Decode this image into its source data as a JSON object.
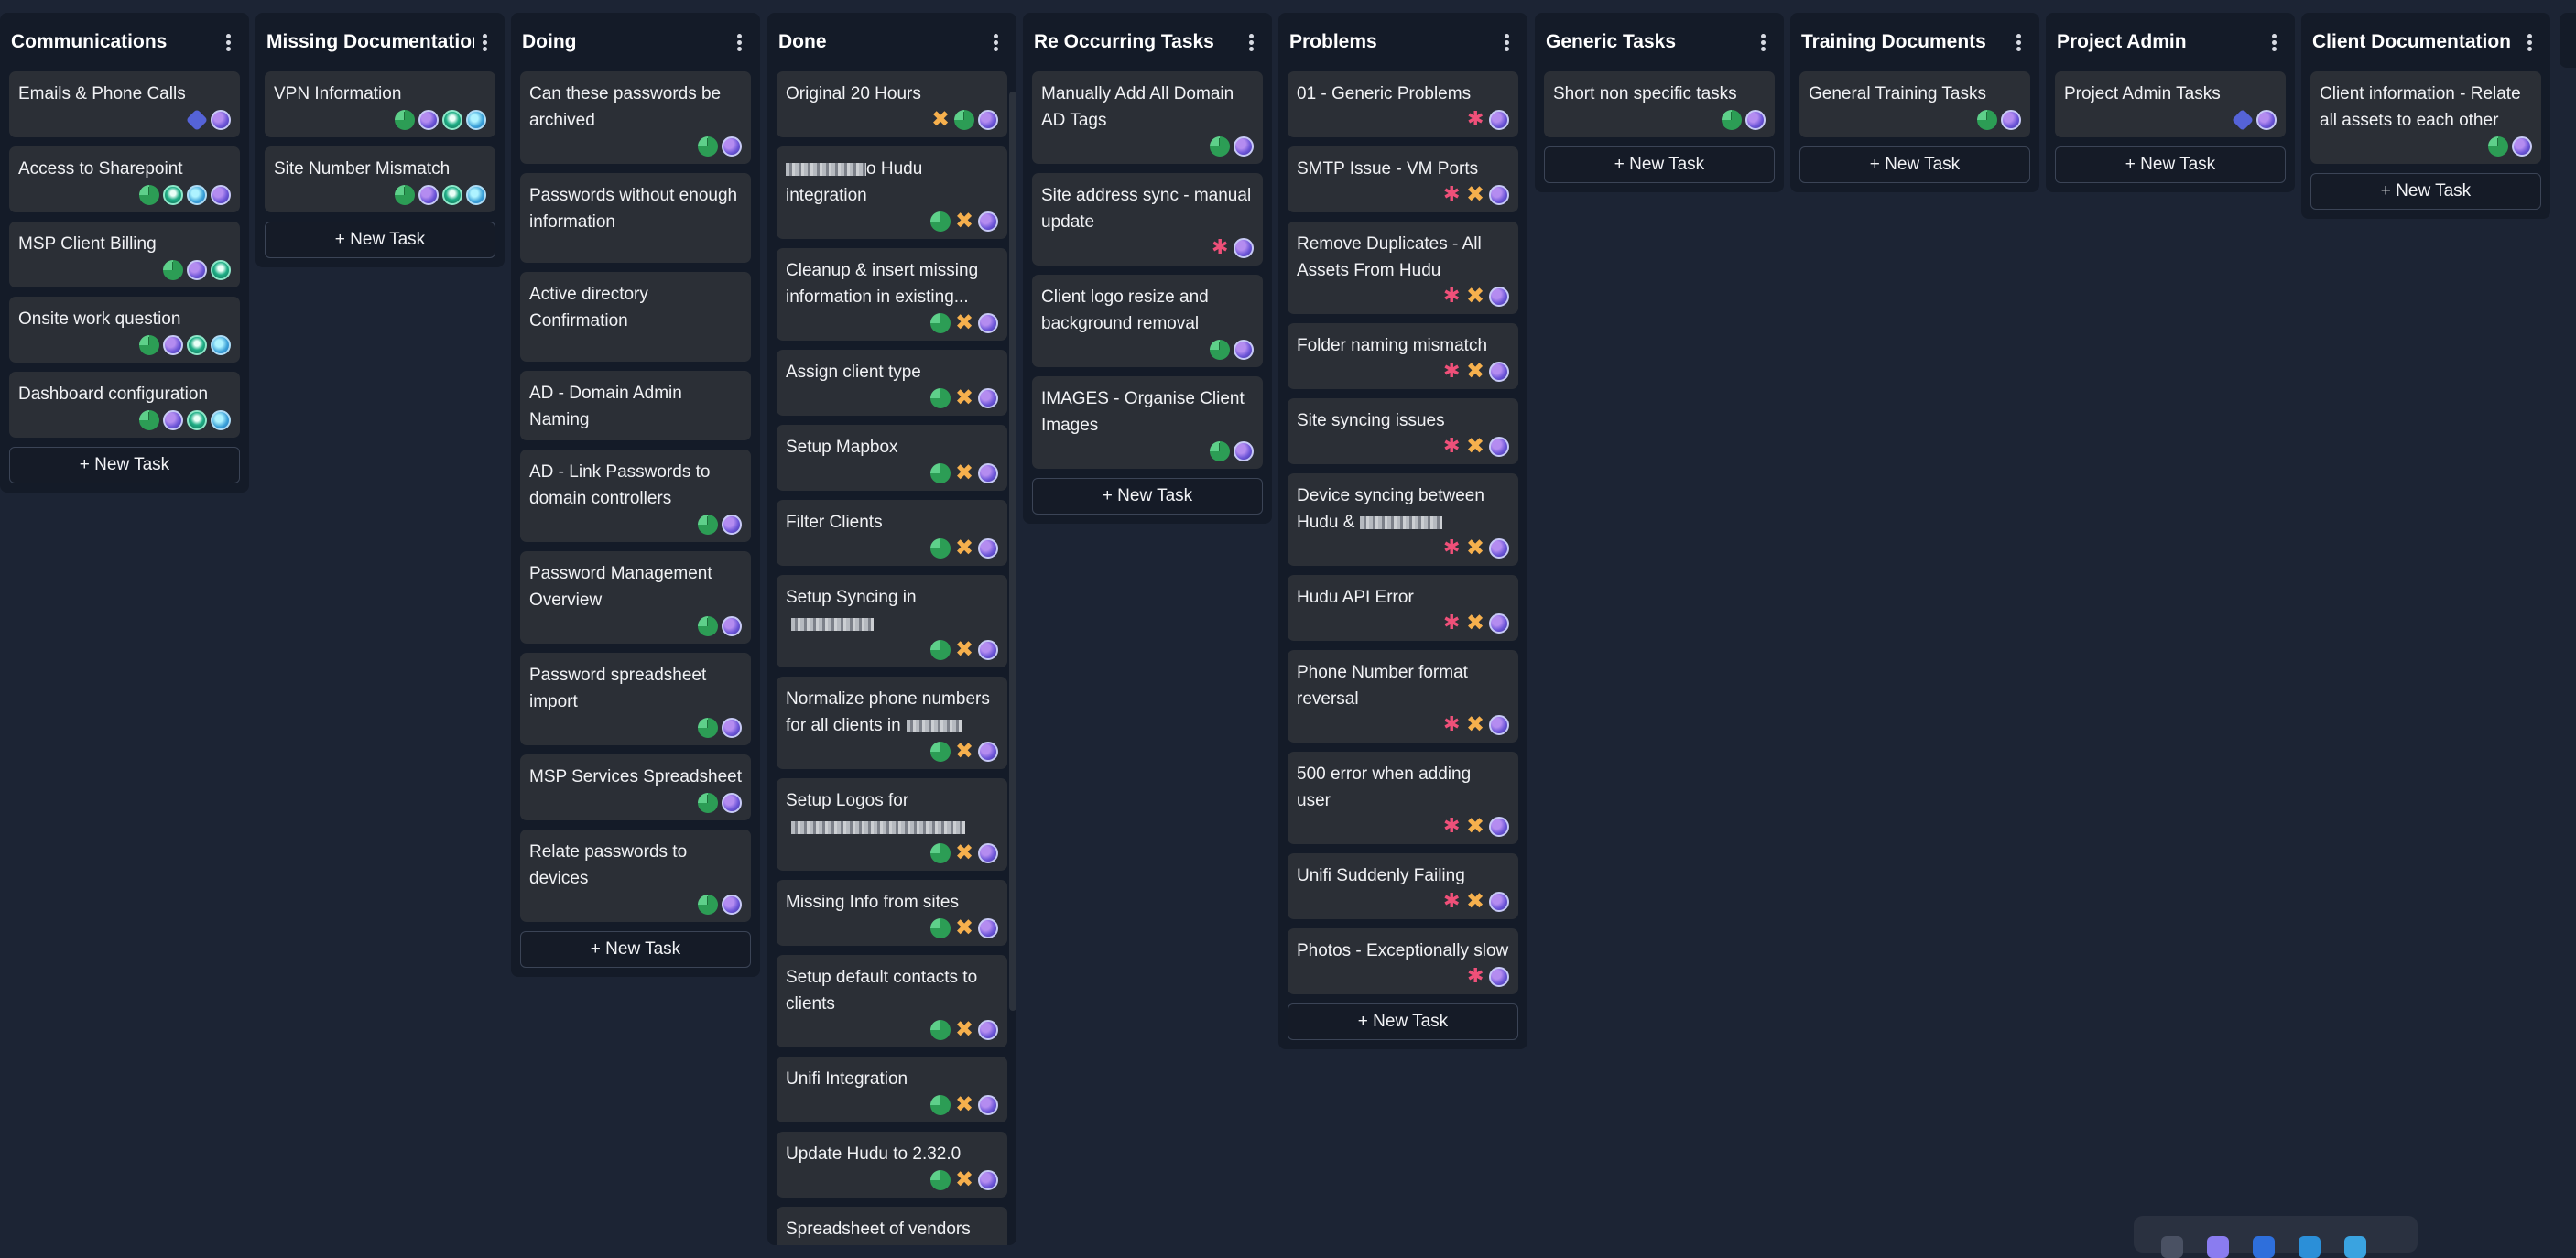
{
  "colors": {
    "background": "#1c2434",
    "column": "#141b28",
    "card": "#2b2f36",
    "text": "#f1f2f5",
    "green_status": "#2c9d55",
    "orange_puzzle": "#f0a340",
    "pink_flower": "#ef5079",
    "purple_avatar": "#6d56d8"
  },
  "new_task_label": "+ New Task",
  "columns": [
    {
      "title": "Communications",
      "cards": [
        {
          "title": "Emails & Phone Calls",
          "icons": [
            "tag-icon",
            "avatar-icon"
          ]
        },
        {
          "title": "Access to Sharepoint",
          "icons": [
            "status-pie-icon",
            "team-icon",
            "globe-icon",
            "avatar-icon"
          ]
        },
        {
          "title": "MSP Client Billing",
          "icons": [
            "status-pie-icon",
            "avatar-icon",
            "team-icon"
          ]
        },
        {
          "title": "Onsite work question",
          "icons": [
            "status-pie-icon",
            "avatar-icon",
            "team-icon",
            "globe-icon"
          ]
        },
        {
          "title": "Dashboard configuration",
          "icons": [
            "status-pie-icon",
            "avatar-icon",
            "team-icon",
            "globe-icon"
          ]
        }
      ]
    },
    {
      "title": "Missing Documentation",
      "cards": [
        {
          "title": "VPN Information",
          "icons": [
            "status-pie-icon",
            "avatar-icon",
            "team-icon",
            "globe-icon"
          ]
        },
        {
          "title": "Site Number Mismatch",
          "icons": [
            "status-pie-icon",
            "avatar-icon",
            "team-icon",
            "globe-icon"
          ]
        }
      ]
    },
    {
      "title": "Doing",
      "cards": [
        {
          "title": "Can these passwords be archived",
          "icons": [
            "status-pie-icon",
            "avatar-icon"
          ]
        },
        {
          "title": "Passwords without enough information",
          "icons": []
        },
        {
          "title": "Active directory Confirmation",
          "icons": []
        },
        {
          "title": "AD - Domain Admin Naming",
          "icons": []
        },
        {
          "title": "AD - Link Passwords to domain controllers",
          "icons": [
            "status-pie-icon",
            "avatar-icon"
          ]
        },
        {
          "title": "Password Management Overview",
          "icons": [
            "status-pie-icon",
            "avatar-icon"
          ]
        },
        {
          "title": "Password spreadsheet import",
          "icons": [
            "status-pie-icon",
            "avatar-icon"
          ]
        },
        {
          "title": "MSP Services Spreadsheet",
          "icons": [
            "status-pie-icon",
            "avatar-icon"
          ]
        },
        {
          "title": "Relate passwords to devices",
          "icons": [
            "status-pie-icon",
            "avatar-icon"
          ]
        }
      ]
    },
    {
      "title": "Done",
      "cards": [
        {
          "title": "Original 20 Hours",
          "icons": [
            "puzzle-icon",
            "status-pie-icon",
            "avatar-icon"
          ]
        },
        {
          "title": "o Hudu integration",
          "icons": [
            "status-pie-icon",
            "puzzle-icon",
            "avatar-icon"
          ]
        },
        {
          "title": "Cleanup & insert missing information in existing...",
          "icons": [
            "status-pie-icon",
            "puzzle-icon",
            "avatar-icon"
          ]
        },
        {
          "title": "Assign client type",
          "icons": [
            "status-pie-icon",
            "puzzle-icon",
            "avatar-icon"
          ]
        },
        {
          "title": "Setup Mapbox",
          "icons": [
            "status-pie-icon",
            "puzzle-icon",
            "avatar-icon"
          ]
        },
        {
          "title": "Filter Clients",
          "icons": [
            "status-pie-icon",
            "puzzle-icon",
            "avatar-icon"
          ]
        },
        {
          "title": "Setup Syncing in",
          "icons": [
            "status-pie-icon",
            "puzzle-icon",
            "avatar-icon"
          ]
        },
        {
          "title": "Normalize phone numbers for all clients in",
          "icons": [
            "status-pie-icon",
            "puzzle-icon",
            "avatar-icon"
          ]
        },
        {
          "title": "Setup Logos for",
          "icons": [
            "status-pie-icon",
            "puzzle-icon",
            "avatar-icon"
          ]
        },
        {
          "title": "Missing Info from sites",
          "icons": [
            "status-pie-icon",
            "puzzle-icon",
            "avatar-icon"
          ]
        },
        {
          "title": "Setup default contacts to clients",
          "icons": [
            "status-pie-icon",
            "puzzle-icon",
            "avatar-icon"
          ]
        },
        {
          "title": "Unifi Integration",
          "icons": [
            "status-pie-icon",
            "puzzle-icon",
            "avatar-icon"
          ]
        },
        {
          "title": "Update Hudu to 2.32.0",
          "icons": [
            "status-pie-icon",
            "puzzle-icon",
            "avatar-icon"
          ]
        },
        {
          "title": "Spreadsheet of vendors",
          "icons": [
            "status-pie-icon",
            "puzzle-icon",
            "avatar-icon"
          ]
        }
      ]
    },
    {
      "title": "Re Occurring Tasks",
      "cards": [
        {
          "title": "Manually Add All Domain AD Tags",
          "icons": [
            "status-pie-icon",
            "avatar-icon"
          ]
        },
        {
          "title": "Site address sync - manual update",
          "icons": [
            "flower-icon",
            "avatar-icon"
          ]
        },
        {
          "title": "Client logo resize and background removal",
          "icons": [
            "status-pie-icon",
            "avatar-icon"
          ]
        },
        {
          "title": "IMAGES - Organise Client Images",
          "icons": [
            "status-pie-icon",
            "avatar-icon"
          ]
        }
      ]
    },
    {
      "title": "Problems",
      "cards": [
        {
          "title": "01 - Generic Problems",
          "icons": [
            "flower-icon",
            "avatar-icon"
          ]
        },
        {
          "title": "SMTP Issue - VM Ports",
          "icons": [
            "flower-icon",
            "puzzle-icon",
            "avatar-icon"
          ]
        },
        {
          "title": "Remove Duplicates - All Assets From Hudu",
          "icons": [
            "flower-icon",
            "puzzle-icon",
            "avatar-icon"
          ]
        },
        {
          "title": "Folder naming mismatch",
          "icons": [
            "flower-icon",
            "puzzle-icon",
            "avatar-icon"
          ]
        },
        {
          "title": "Site syncing issues",
          "icons": [
            "flower-icon",
            "puzzle-icon",
            "avatar-icon"
          ]
        },
        {
          "title": "Device syncing between Hudu &",
          "icons": [
            "flower-icon",
            "puzzle-icon",
            "avatar-icon"
          ]
        },
        {
          "title": "Hudu API Error",
          "icons": [
            "flower-icon",
            "puzzle-icon",
            "avatar-icon"
          ]
        },
        {
          "title": "Phone Number format reversal",
          "icons": [
            "flower-icon",
            "puzzle-icon",
            "avatar-icon"
          ]
        },
        {
          "title": "500 error when adding user",
          "icons": [
            "flower-icon",
            "puzzle-icon",
            "avatar-icon"
          ]
        },
        {
          "title": "Unifi Suddenly Failing",
          "icons": [
            "flower-icon",
            "puzzle-icon",
            "avatar-icon"
          ]
        },
        {
          "title": "Photos - Exceptionally slow",
          "icons": [
            "flower-icon",
            "avatar-icon"
          ]
        }
      ]
    },
    {
      "title": "Generic Tasks",
      "cards": [
        {
          "title": "Short non specific tasks",
          "icons": [
            "status-pie-icon",
            "avatar-icon"
          ]
        }
      ]
    },
    {
      "title": "Training Documents",
      "cards": [
        {
          "title": "General Training Tasks",
          "icons": [
            "status-pie-icon",
            "avatar-icon"
          ]
        }
      ]
    },
    {
      "title": "Project Admin",
      "cards": [
        {
          "title": "Project Admin Tasks",
          "icons": [
            "tag-icon",
            "avatar-icon"
          ]
        }
      ]
    },
    {
      "title": "Client Documentation",
      "cards": [
        {
          "title": "Client information - Relate all assets to each other",
          "icons": [
            "status-pie-icon",
            "avatar-icon"
          ]
        }
      ]
    }
  ]
}
